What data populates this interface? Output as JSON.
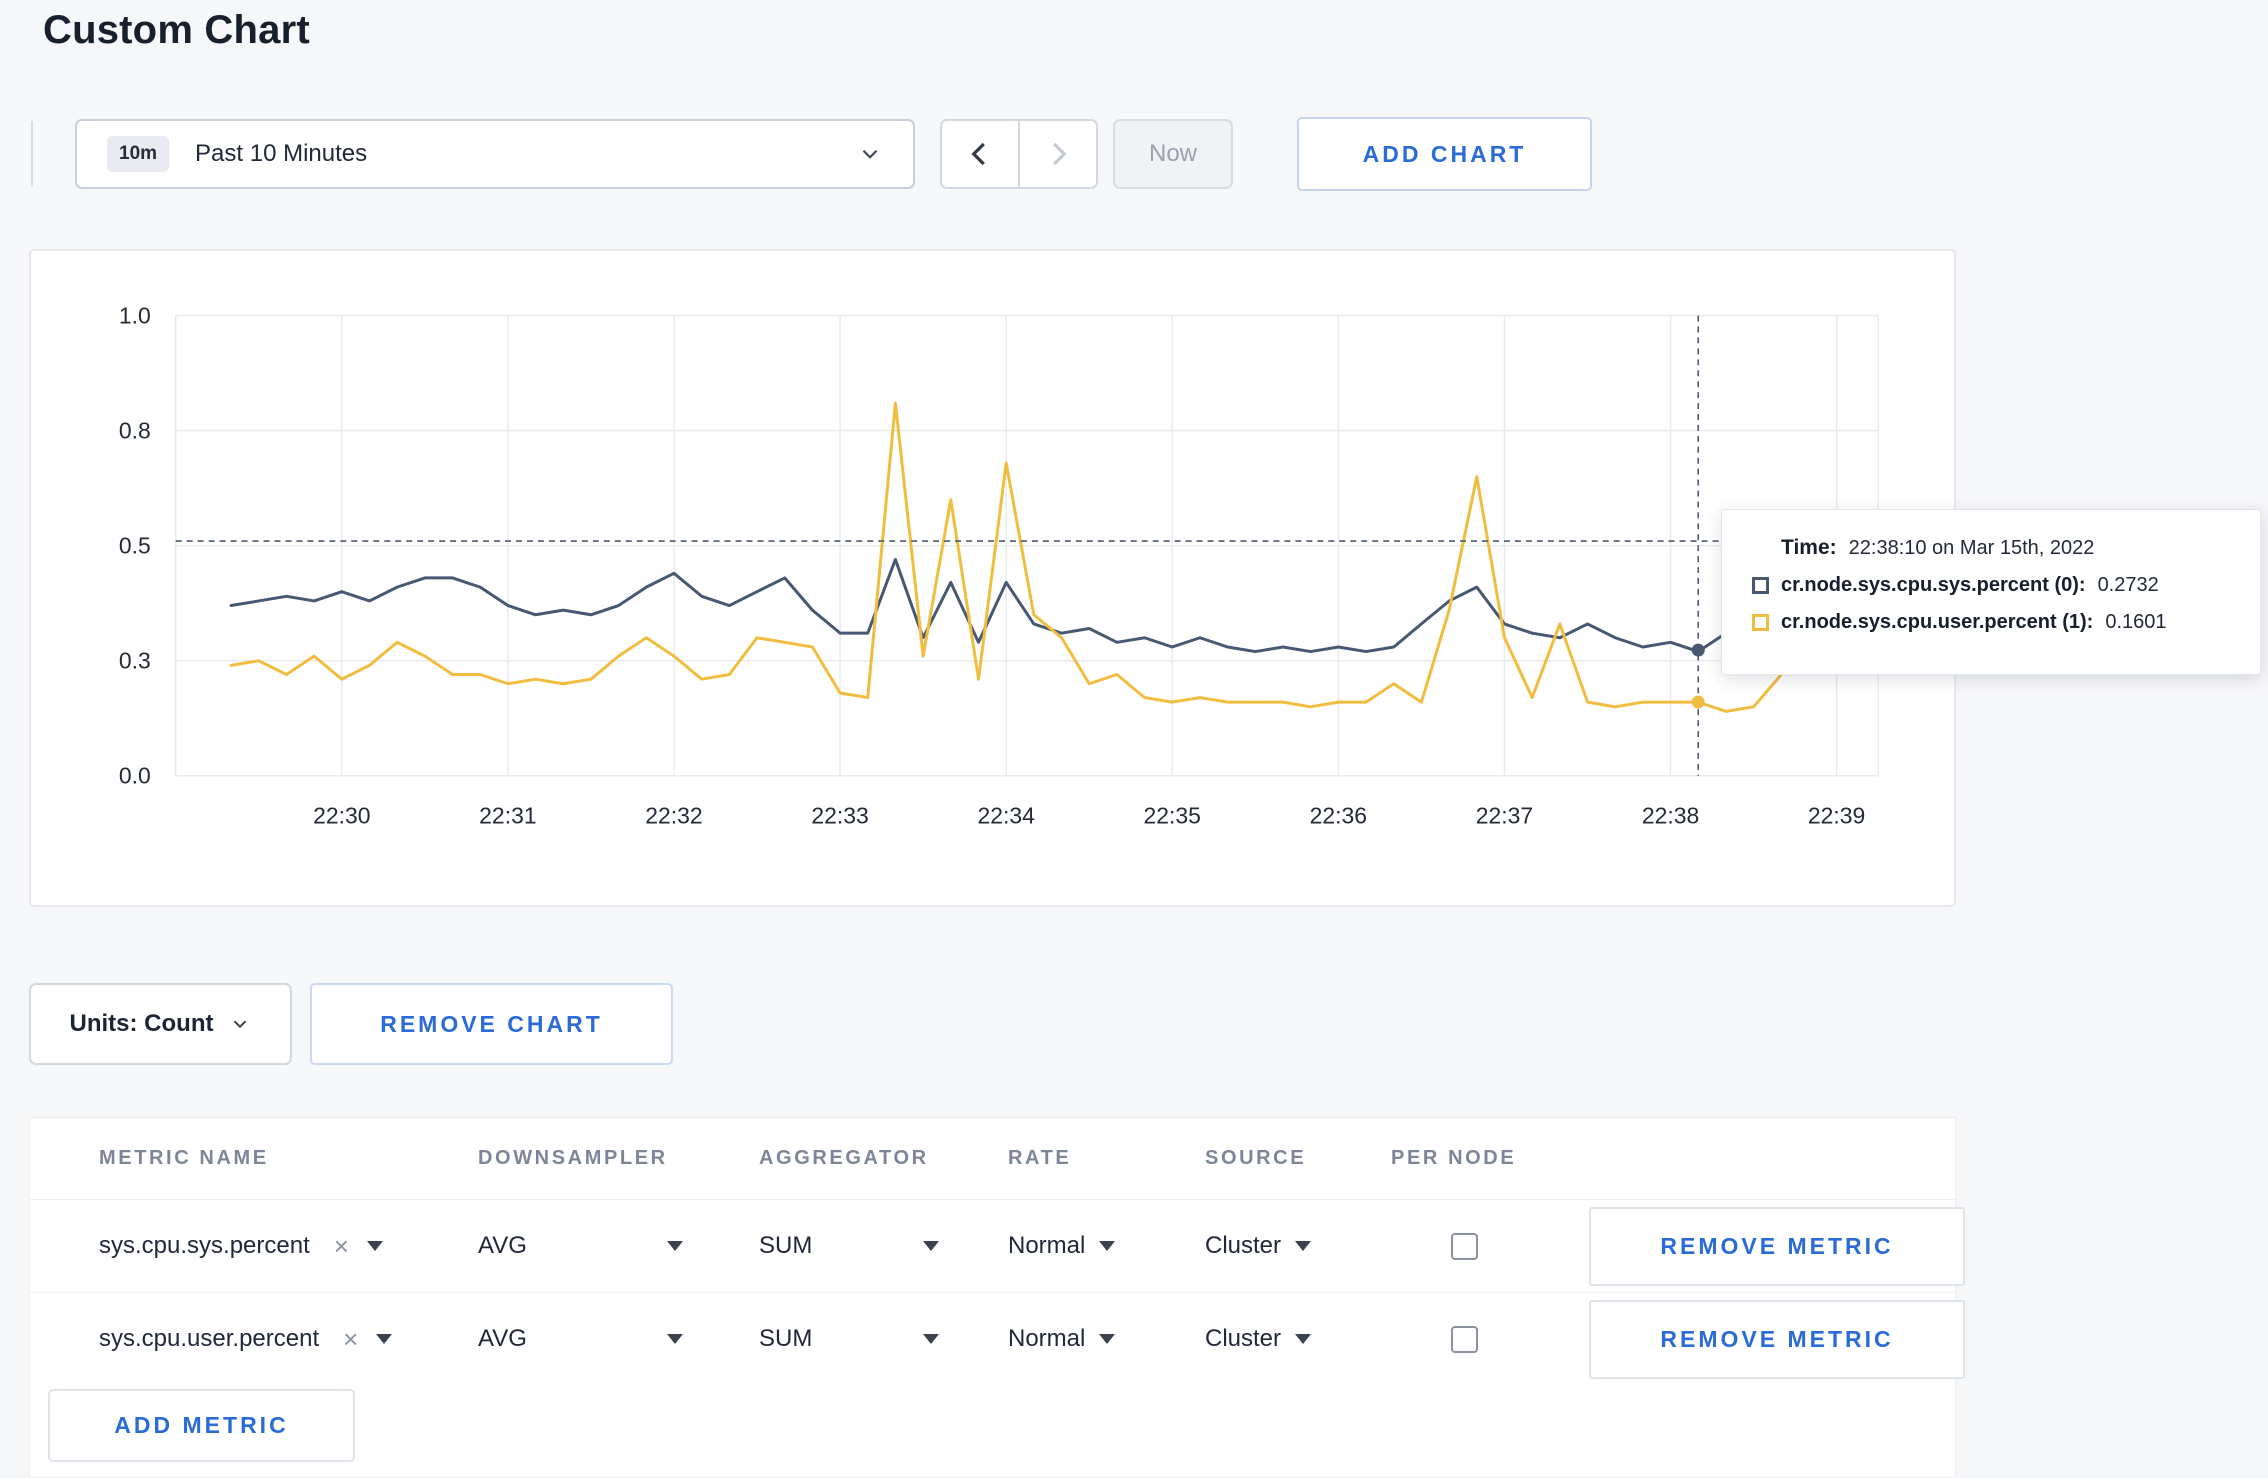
{
  "page": {
    "title": "Custom Chart"
  },
  "toolbar": {
    "time_window_badge": "10m",
    "time_window_label": "Past 10 Minutes",
    "now_label": "Now",
    "add_chart_label": "ADD CHART"
  },
  "chart_controls": {
    "units_label": "Units: Count",
    "remove_chart_label": "REMOVE CHART",
    "add_metric_label": "ADD METRIC"
  },
  "tooltip": {
    "time_label": "Time:",
    "time_value": "22:38:10 on Mar 15th, 2022",
    "series": [
      {
        "name": "cr.node.sys.cpu.sys.percent (0):",
        "value": "0.2732",
        "color": "#475872"
      },
      {
        "name": "cr.node.sys.cpu.user.percent (1):",
        "value": "0.1601",
        "color": "#f1bd3f"
      }
    ]
  },
  "metrics_table": {
    "headers": [
      "METRIC NAME",
      "DOWNSAMPLER",
      "AGGREGATOR",
      "RATE",
      "SOURCE",
      "PER NODE"
    ],
    "remove_metric_label": "REMOVE METRIC",
    "rows": [
      {
        "metric": "sys.cpu.sys.percent",
        "downsampler": "AVG",
        "aggregator": "SUM",
        "rate": "Normal",
        "source": "Cluster",
        "per_node": false
      },
      {
        "metric": "sys.cpu.user.percent",
        "downsampler": "AVG",
        "aggregator": "SUM",
        "rate": "Normal",
        "source": "Cluster",
        "per_node": false
      }
    ]
  },
  "chart_data": {
    "type": "line",
    "title": "",
    "x_axis": {
      "note": "x values are minutes after 22:00",
      "tick_values": [
        30,
        31,
        32,
        33,
        34,
        35,
        36,
        37,
        38,
        39
      ],
      "tick_labels": [
        "22:30",
        "22:31",
        "22:32",
        "22:33",
        "22:34",
        "22:35",
        "22:36",
        "22:37",
        "22:38",
        "22:39"
      ],
      "domain_minutes": [
        29.0,
        39.25
      ]
    },
    "y_axis": {
      "tick_values": [
        0,
        0.25,
        0.5,
        0.75,
        1.0
      ],
      "tick_labels": [
        "0.0",
        "0.3",
        "0.5",
        "0.8",
        "1.0"
      ],
      "ylim": [
        0,
        1
      ]
    },
    "grid": true,
    "x_start": 29.3333,
    "x_step": 0.16667,
    "series": [
      {
        "name": "cr.node.sys.cpu.sys.percent",
        "color": "#475872",
        "values": [
          0.37,
          0.38,
          0.39,
          0.38,
          0.4,
          0.38,
          0.41,
          0.43,
          0.43,
          0.41,
          0.37,
          0.35,
          0.36,
          0.35,
          0.37,
          0.41,
          0.44,
          0.39,
          0.37,
          0.4,
          0.43,
          0.36,
          0.31,
          0.31,
          0.47,
          0.3,
          0.42,
          0.29,
          0.42,
          0.33,
          0.31,
          0.32,
          0.29,
          0.3,
          0.28,
          0.3,
          0.28,
          0.27,
          0.28,
          0.27,
          0.28,
          0.27,
          0.28,
          0.33,
          0.38,
          0.41,
          0.33,
          0.31,
          0.3,
          0.33,
          0.3,
          0.28,
          0.29,
          0.27,
          0.31,
          0.3,
          0.32,
          0.3,
          0.3,
          0.31
        ]
      },
      {
        "name": "cr.node.sys.cpu.user.percent",
        "color": "#f1bd3f",
        "values": [
          0.24,
          0.25,
          0.22,
          0.26,
          0.21,
          0.24,
          0.29,
          0.26,
          0.22,
          0.22,
          0.2,
          0.21,
          0.2,
          0.21,
          0.26,
          0.3,
          0.26,
          0.21,
          0.22,
          0.3,
          0.29,
          0.28,
          0.18,
          0.17,
          0.81,
          0.26,
          0.6,
          0.21,
          0.68,
          0.35,
          0.3,
          0.2,
          0.22,
          0.17,
          0.16,
          0.17,
          0.16,
          0.16,
          0.16,
          0.15,
          0.16,
          0.16,
          0.2,
          0.16,
          0.36,
          0.65,
          0.3,
          0.17,
          0.33,
          0.16,
          0.15,
          0.16,
          0.16,
          0.16,
          0.14,
          0.15,
          0.22,
          0.3,
          0.28,
          0.26
        ]
      }
    ],
    "crosshair": {
      "x_minutes": 38.1667,
      "hline_value": 0.51,
      "points": [
        {
          "series": 0,
          "value": 0.2732
        },
        {
          "series": 1,
          "value": 0.1601
        }
      ]
    },
    "legend": "tooltip"
  }
}
